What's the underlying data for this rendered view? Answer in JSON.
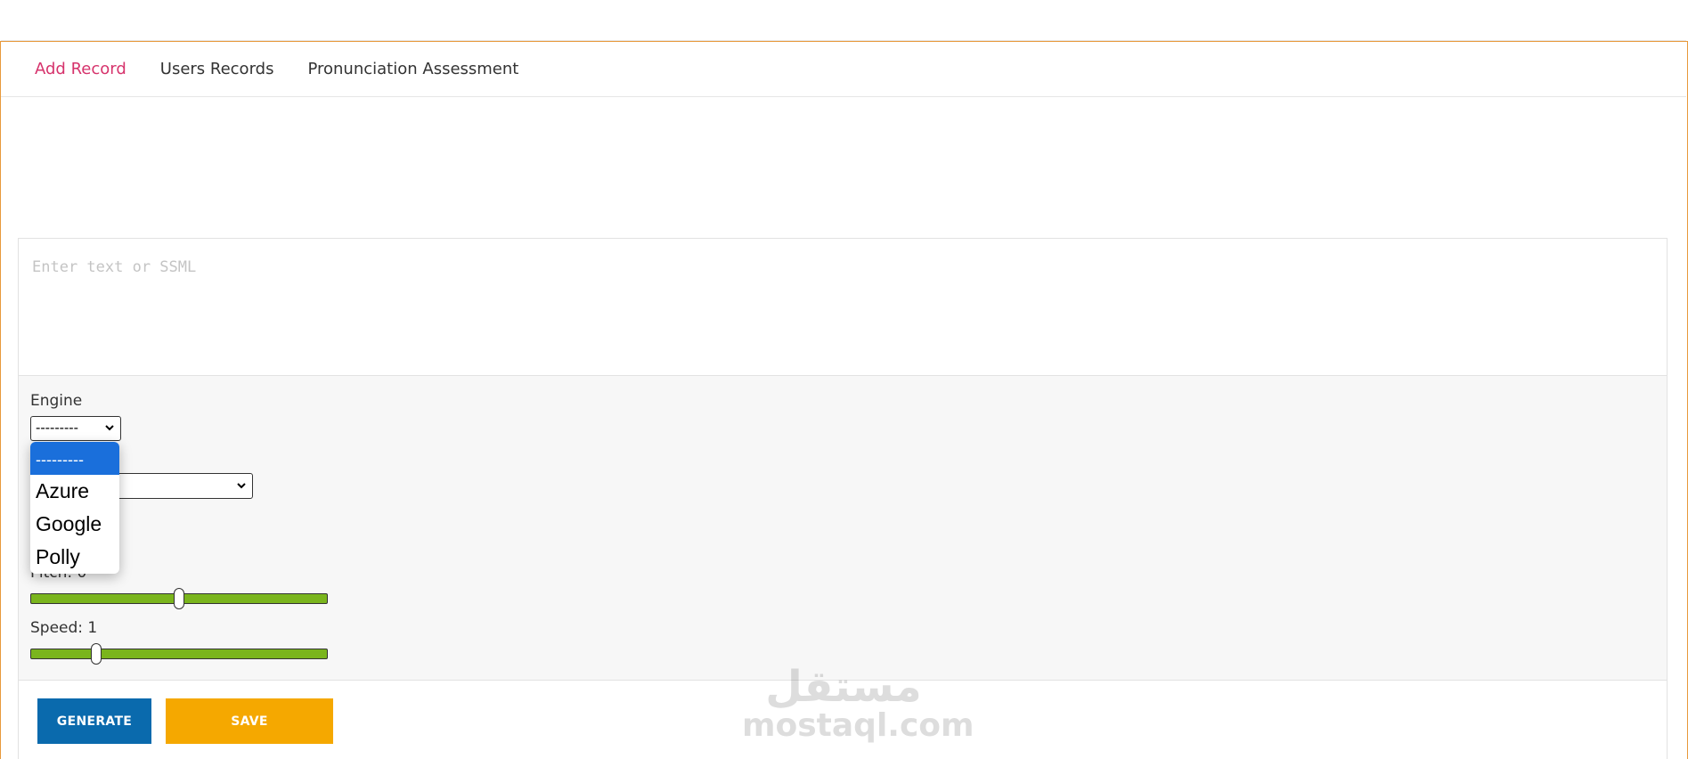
{
  "tabs": [
    {
      "label": "Add Record",
      "active": true
    },
    {
      "label": "Users Records",
      "active": false
    },
    {
      "label": "Pronunciation Assessment",
      "active": false
    }
  ],
  "editor": {
    "placeholder": "Enter text or SSML",
    "value": ""
  },
  "engine": {
    "label": "Engine",
    "selected": "---------",
    "options": [
      "---------",
      "Azure",
      "Google",
      "Polly"
    ]
  },
  "voice": {
    "selected": ""
  },
  "pitch": {
    "label": "Pitch: 0",
    "value_fraction": 0.5
  },
  "speed": {
    "label": "Speed: 1",
    "value_fraction": 0.21
  },
  "buttons": {
    "generate": "GENERATE",
    "save": "SAVE"
  },
  "watermark": {
    "arabic": "مستقل",
    "latin": "mostaql.com"
  },
  "colors": {
    "frame_border": "#e89a3c",
    "active_tab": "#d6336c",
    "slider_fill": "#7ab51d",
    "generate_button": "#0a6aad",
    "save_button": "#f5a800",
    "dropdown_highlight": "#1a6fdb"
  }
}
